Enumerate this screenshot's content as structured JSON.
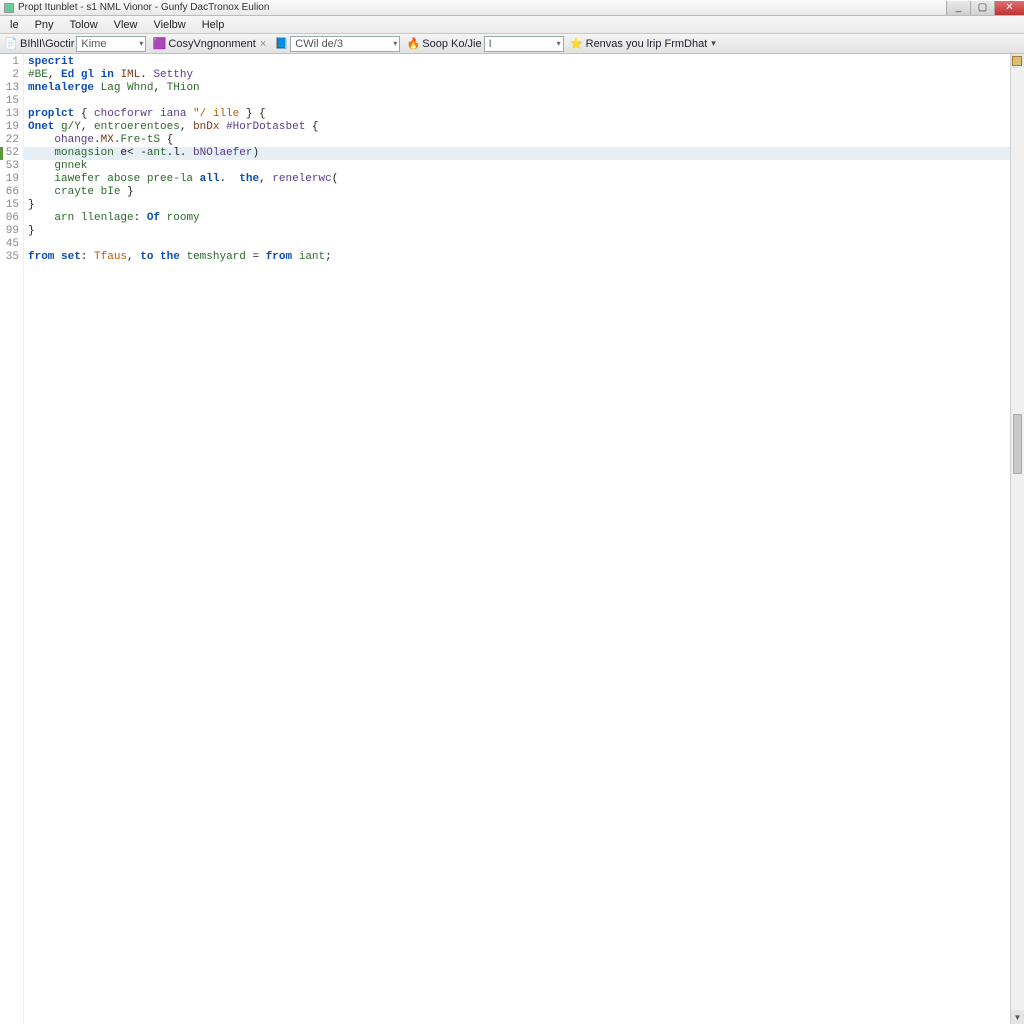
{
  "window": {
    "title": "Propt Itunblet - s1 NML Vionor - Gunfy DacTronox Eulion"
  },
  "menu": {
    "items": [
      "le",
      "Pny",
      "Tolow",
      "Vlew",
      "Vielbw",
      "Help"
    ]
  },
  "toolbar": {
    "group1_label": "BIhlI\\Goctir",
    "group1_combo": "Kime",
    "group2_label": "CosyVngnonment",
    "group3_label": "CWil de/3",
    "group4_label": "Soop Ko/Jie",
    "group4_combo": "I",
    "group5_label": "Renvas you lrip FrmDhat"
  },
  "gutter_lines": [
    "1",
    "2",
    "13",
    "15",
    "13",
    "19",
    "22",
    "52",
    "53",
    "19",
    "66",
    "15",
    "06",
    "99",
    "45",
    "35"
  ],
  "code_lines": [
    {
      "hl": false,
      "segments": [
        [
          "kw",
          "specrit"
        ]
      ]
    },
    {
      "hl": false,
      "segments": [
        [
          "id",
          "#BE"
        ],
        [
          "op",
          ", "
        ],
        [
          "kw",
          "Ed gl "
        ],
        [
          "kw",
          "in "
        ],
        [
          "type",
          "IML"
        ],
        [
          "op",
          ". "
        ],
        [
          "fn",
          "Setthy"
        ]
      ]
    },
    {
      "hl": false,
      "segments": [
        [
          "kw",
          "mnelalerge "
        ],
        [
          "id",
          "Lag "
        ],
        [
          "id",
          "Whnd"
        ],
        [
          "op",
          ", "
        ],
        [
          "id",
          "THion"
        ]
      ]
    },
    {
      "hl": false,
      "segments": []
    },
    {
      "hl": false,
      "segments": [
        [
          "kw",
          "proplct "
        ],
        [
          "op",
          "{ "
        ],
        [
          "fn",
          "chocforwr iana "
        ],
        [
          "str",
          "\"/ ille "
        ],
        [
          "op",
          "} {"
        ]
      ]
    },
    {
      "hl": false,
      "segments": [
        [
          "kw",
          "Onet "
        ],
        [
          "id",
          "g/Y"
        ],
        [
          "op",
          ", "
        ],
        [
          "id",
          "entroerentoes"
        ],
        [
          "op",
          ", "
        ],
        [
          "type",
          "bnDx "
        ],
        [
          "fn",
          "#HorDotasbet"
        ],
        [
          "op",
          " {"
        ]
      ]
    },
    {
      "hl": false,
      "segments": [
        [
          "op",
          "    "
        ],
        [
          "fn",
          "ohange"
        ],
        [
          "op",
          "."
        ],
        [
          "type",
          "MX"
        ],
        [
          "op",
          "."
        ],
        [
          "id",
          "Fre-tS"
        ],
        [
          "op",
          " {"
        ]
      ]
    },
    {
      "hl": true,
      "segments": [
        [
          "op",
          "    "
        ],
        [
          "id",
          "monagsion "
        ],
        [
          "op",
          "e< -"
        ],
        [
          "id",
          "ant"
        ],
        [
          "op",
          ".l. "
        ],
        [
          "fn",
          "bNOlaefer"
        ],
        [
          "op",
          ")"
        ]
      ]
    },
    {
      "hl": false,
      "segments": [
        [
          "op",
          "    "
        ],
        [
          "id",
          "gnnek"
        ]
      ]
    },
    {
      "hl": false,
      "segments": [
        [
          "op",
          "    "
        ],
        [
          "id",
          "iawefer "
        ],
        [
          "id",
          "abose "
        ],
        [
          "id",
          "pree-la "
        ],
        [
          "kw",
          "all"
        ],
        [
          "op",
          ".  "
        ],
        [
          "kw",
          "the"
        ],
        [
          "op",
          ", "
        ],
        [
          "fn",
          "renelerwc"
        ],
        [
          "op",
          "("
        ]
      ]
    },
    {
      "hl": false,
      "segments": [
        [
          "op",
          "    "
        ],
        [
          "id",
          "crayte "
        ],
        [
          "id",
          "bIe"
        ],
        [
          "op",
          " }"
        ]
      ]
    },
    {
      "hl": false,
      "segments": [
        [
          "op",
          "}"
        ]
      ]
    },
    {
      "hl": false,
      "segments": [
        [
          "op",
          "    "
        ],
        [
          "id",
          "arn "
        ],
        [
          "id",
          "llenlage"
        ],
        [
          "op",
          ": "
        ],
        [
          "kw",
          "Of "
        ],
        [
          "id",
          "roomy"
        ]
      ]
    },
    {
      "hl": false,
      "segments": [
        [
          "op",
          "}"
        ]
      ]
    },
    {
      "hl": false,
      "segments": []
    },
    {
      "hl": false,
      "segments": [
        [
          "kw",
          "from "
        ],
        [
          "kw",
          "set"
        ],
        [
          "op",
          ": "
        ],
        [
          "str",
          "Tfaus"
        ],
        [
          "op",
          ", "
        ],
        [
          "kw",
          "to the "
        ],
        [
          "id",
          "temshyard"
        ],
        [
          "op",
          " = "
        ],
        [
          "kw",
          "from "
        ],
        [
          "id",
          "iant"
        ],
        [
          "op",
          ";"
        ]
      ]
    }
  ]
}
